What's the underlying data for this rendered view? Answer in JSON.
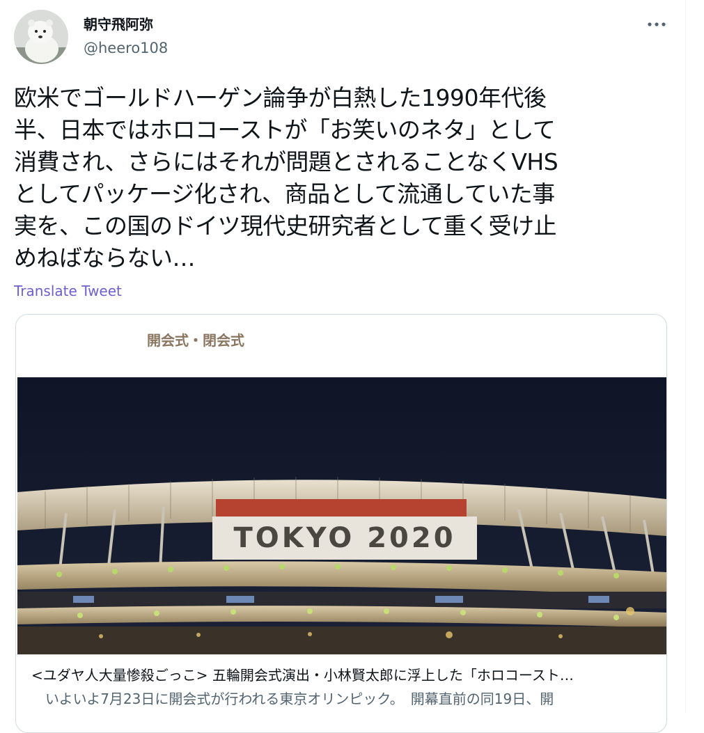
{
  "author": {
    "display_name": "朝守飛阿弥",
    "handle": "@heero108",
    "avatar_icon": "polar-bear-avatar"
  },
  "more_icon": "more-horizontal-icon",
  "tweet": {
    "lines": [
      "欧米でゴールドハーゲン論争が白熱した1990年代後",
      "半、日本ではホロコーストが「お笑いのネタ」として",
      "消費され、さらにはそれが問題とされることなくVHS",
      "としてパッケージ化され、商品として流通していた事",
      "実を、この国のドイツ現代史研究者として重く受け止",
      "めねばならない…"
    ],
    "translate_label": "Translate Tweet"
  },
  "card": {
    "header_text": "開会式・閉会式",
    "banner_text": "TOKYO 2020",
    "title": "<ユダヤ人大量惨殺ごっこ> 五輪開会式演出・小林賢太郎に浮上した「ホロコースト…",
    "description": "いよいよ7月23日に開会式が行われる東京オリンピック。　開幕直前の同19日、開"
  },
  "colors": {
    "text": "#0f1419",
    "secondary": "#536471",
    "link": "#6e5fd0",
    "border": "#cfd9de",
    "header_text": "#8a7660",
    "night_sky": "#141b2e"
  }
}
